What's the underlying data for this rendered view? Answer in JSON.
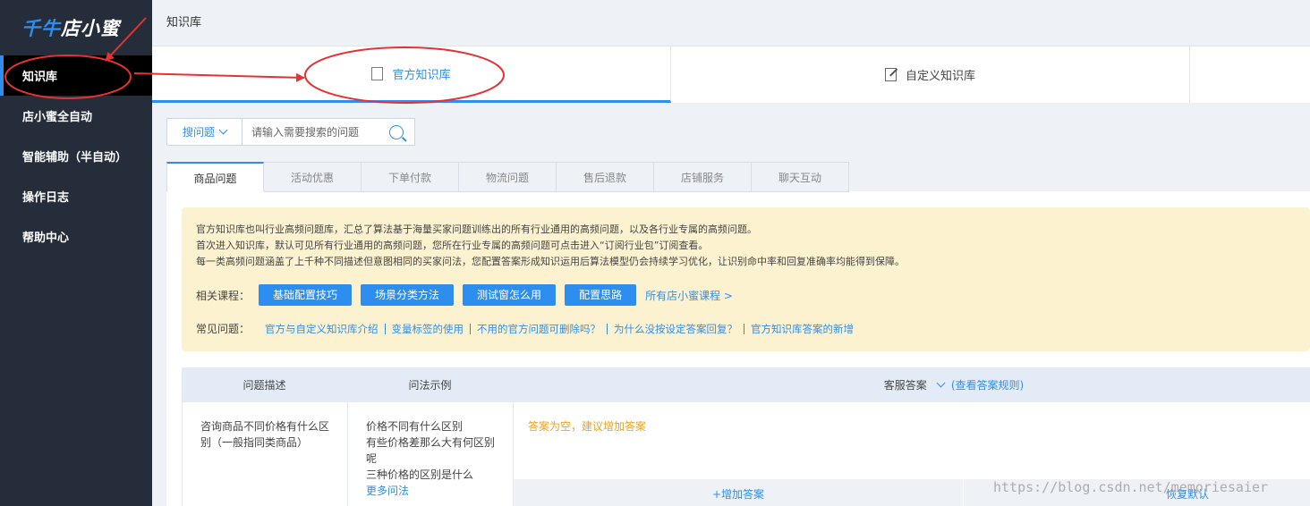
{
  "sidebar": {
    "logo_part1": "千牛",
    "logo_part2": "店小蜜",
    "items": [
      {
        "label": "知识库",
        "active": true
      },
      {
        "label": "店小蜜全自动"
      },
      {
        "label": "智能辅助（半自动）"
      },
      {
        "label": "操作日志"
      },
      {
        "label": "帮助中心"
      }
    ]
  },
  "breadcrumb": "知识库",
  "top_tabs": [
    {
      "label": "官方知识库",
      "icon": "book-icon",
      "active": true
    },
    {
      "label": "自定义知识库",
      "icon": "edit-icon"
    }
  ],
  "search": {
    "type_label": "搜问题",
    "placeholder": "请输入需要搜索的问题"
  },
  "category_tabs": [
    "商品问题",
    "活动优惠",
    "下单付款",
    "物流问题",
    "售后退款",
    "店铺服务",
    "聊天互动"
  ],
  "notice": {
    "lines": [
      "官方知识库也叫行业高频问题库，汇总了算法基于海量买家问题训练出的所有行业通用的高频问题，以及各行业专属的高频问题。",
      "首次进入知识库，默认可见所有行业通用的高频问题，您所在行业专属的高频问题可点击进入“订阅行业包”订阅查看。",
      "每一类高频问题涵盖了上千种不同描述但意图相同的买家问法，您配置答案形成知识运用后算法模型仍会持续学习优化，让识别命中率和回复准确率均能得到保障。"
    ],
    "courses_label": "相关课程：",
    "courses": [
      "基础配置技巧",
      "场景分类方法",
      "测试窗怎么用",
      "配置思路"
    ],
    "all_courses": "所有店小蜜课程 >",
    "faq_label": "常见问题：",
    "faqs": [
      "官方与自定义知识库介绍",
      "变量标签的使用",
      "不用的官方问题可删除吗？",
      "为什么没按设定答案回复？",
      "官方知识库答案的新增"
    ]
  },
  "table": {
    "headers": {
      "description": "问题描述",
      "examples": "问法示例",
      "answer": "客服答案",
      "rules_link": "(查看答案规则)"
    },
    "rows": [
      {
        "description": "咨询商品不同价格有什么区别（一般指同类商品）",
        "examples": [
          "价格不同有什么区别",
          "有些价格差那么大有何区别呢",
          "三种价格的区别是什么"
        ],
        "more": "更多问法",
        "empty_answer": "答案为空，建议增加答案",
        "add_answer": "+增加答案",
        "restore": "恢复默认"
      }
    ]
  },
  "watermark": "https://blog.csdn.net/memoriesaier",
  "colors": {
    "accent": "#2e8ef0",
    "sidebar_bg": "#262d3a",
    "annotation_red": "#e53333",
    "notice_bg": "#fdf2d0",
    "warning_text": "#f0a020"
  }
}
